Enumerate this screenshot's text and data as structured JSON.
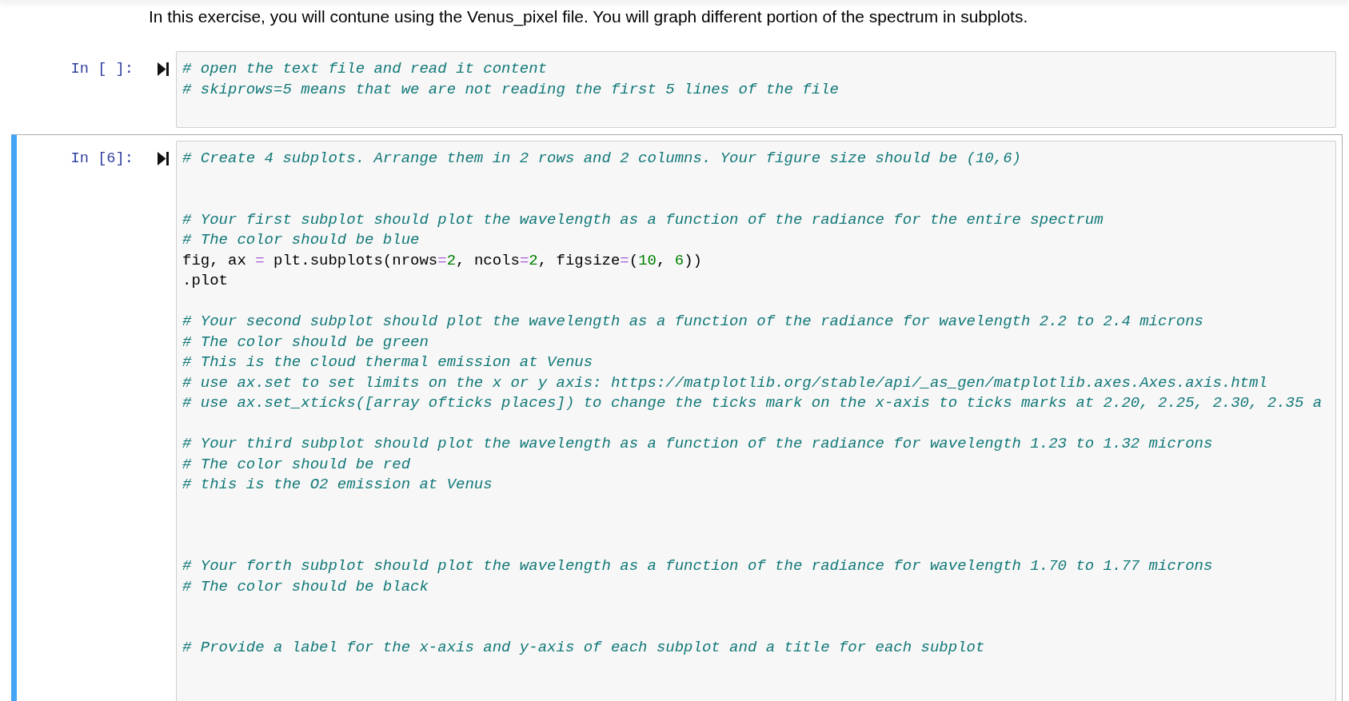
{
  "markdown": {
    "text": "In this exercise, you will contune using the Venus_pixel file. You will graph different portion of the spectrum in subplots."
  },
  "cells": [
    {
      "prompt": "In [ ]:",
      "selected": false,
      "lines": [
        {
          "kind": "comment",
          "text": "# open the text file and read it content"
        },
        {
          "kind": "comment",
          "text": "# skiprows=5 means that we are not reading the first 5 lines of the file"
        }
      ]
    },
    {
      "prompt": "In [6]:",
      "selected": true,
      "lines": [
        {
          "kind": "comment",
          "text": "# Create 4 subplots. Arrange them in 2 rows and 2 columns. Your figure size should be (10,6)"
        },
        {
          "kind": "blank"
        },
        {
          "kind": "blank"
        },
        {
          "kind": "comment",
          "text": "# Your first subplot should plot the wavelength as a function of the radiance for the entire spectrum"
        },
        {
          "kind": "comment",
          "text": "# The color should be blue"
        },
        {
          "kind": "code",
          "tokens": [
            {
              "kind": "text",
              "text": "fig, ax "
            },
            {
              "kind": "operator",
              "text": "="
            },
            {
              "kind": "text",
              "text": " plt.subplots(nrows"
            },
            {
              "kind": "operator",
              "text": "="
            },
            {
              "kind": "number",
              "text": "2"
            },
            {
              "kind": "text",
              "text": ", ncols"
            },
            {
              "kind": "operator",
              "text": "="
            },
            {
              "kind": "number",
              "text": "2"
            },
            {
              "kind": "text",
              "text": ", figsize"
            },
            {
              "kind": "operator",
              "text": "="
            },
            {
              "kind": "text",
              "text": "("
            },
            {
              "kind": "number",
              "text": "10"
            },
            {
              "kind": "text",
              "text": ", "
            },
            {
              "kind": "number",
              "text": "6"
            },
            {
              "kind": "text",
              "text": "))"
            }
          ]
        },
        {
          "kind": "code",
          "tokens": [
            {
              "kind": "text",
              "text": ".plot"
            }
          ]
        },
        {
          "kind": "blank"
        },
        {
          "kind": "comment",
          "text": "# Your second subplot should plot the wavelength as a function of the radiance for wavelength 2.2 to 2.4 microns"
        },
        {
          "kind": "comment",
          "text": "# The color should be green"
        },
        {
          "kind": "comment",
          "text": "# This is the cloud thermal emission at Venus"
        },
        {
          "kind": "comment",
          "text": "# use ax.set to set limits on the x or y axis: https://matplotlib.org/stable/api/_as_gen/matplotlib.axes.Axes.axis.html"
        },
        {
          "kind": "comment",
          "text": "# use ax.set_xticks([array ofticks places]) to change the ticks mark on the x-axis to ticks marks at 2.20, 2.25, 2.30, 2.35 a"
        },
        {
          "kind": "blank"
        },
        {
          "kind": "comment",
          "text": "# Your third subplot should plot the wavelength as a function of the radiance for wavelength 1.23 to 1.32 microns"
        },
        {
          "kind": "comment",
          "text": "# The color should be red"
        },
        {
          "kind": "comment",
          "text": "# this is the O2 emission at Venus"
        },
        {
          "kind": "blank"
        },
        {
          "kind": "blank"
        },
        {
          "kind": "blank"
        },
        {
          "kind": "comment",
          "text": "# Your forth subplot should plot the wavelength as a function of the radiance for wavelength 1.70 to 1.77 microns"
        },
        {
          "kind": "comment",
          "text": "# The color should be black"
        },
        {
          "kind": "blank"
        },
        {
          "kind": "blank"
        },
        {
          "kind": "comment",
          "text": "# Provide a label for the x-axis and y-axis of each subplot and a title for each subplot"
        }
      ]
    }
  ]
}
